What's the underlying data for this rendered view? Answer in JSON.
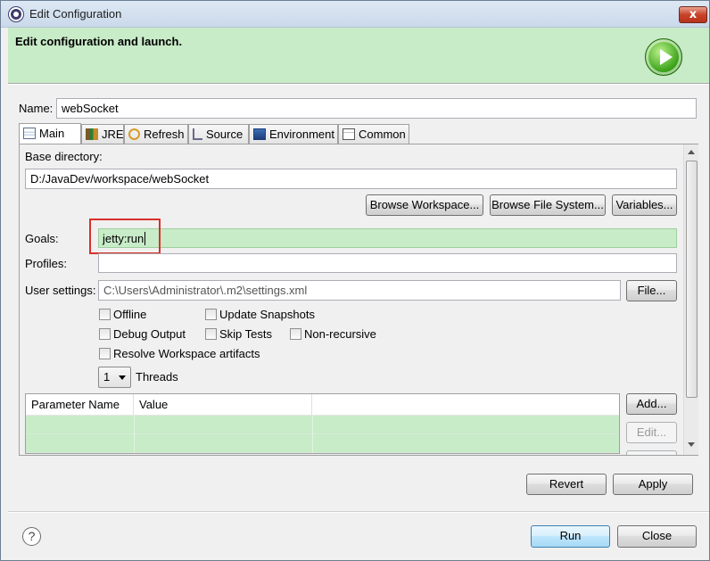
{
  "window": {
    "title": "Edit Configuration",
    "close_glyph": "x"
  },
  "banner": {
    "text": "Edit configuration and launch."
  },
  "name": {
    "label": "Name:",
    "value": "webSocket"
  },
  "tabs": [
    {
      "label": "Main",
      "icon": "document-icon"
    },
    {
      "label": "JRE",
      "icon": "jre-library-icon"
    },
    {
      "label": "Refresh",
      "icon": "refresh-icon"
    },
    {
      "label": "Source",
      "icon": "source-icon"
    },
    {
      "label": "Environment",
      "icon": "environment-icon"
    },
    {
      "label": "Common",
      "icon": "common-icon"
    }
  ],
  "main": {
    "base_dir_label": "Base directory:",
    "base_dir_value": "D:/JavaDev/workspace/webSocket",
    "browse_workspace": "Browse Workspace...",
    "browse_fs": "Browse File System...",
    "variables": "Variables...",
    "goals_label": "Goals:",
    "goals_value": "jetty:run",
    "profiles_label": "Profiles:",
    "profiles_value": "",
    "user_settings_label": "User settings:",
    "user_settings_value": "C:\\Users\\Administrator\\.m2\\settings.xml",
    "file_button": "File...",
    "options": {
      "offline": "Offline",
      "update_snapshots": "Update Snapshots",
      "debug_output": "Debug Output",
      "skip_tests": "Skip Tests",
      "non_recursive": "Non-recursive",
      "resolve_workspace": "Resolve Workspace artifacts"
    },
    "threads_value": "1",
    "threads_label": "Threads",
    "table": {
      "col_name": "Parameter Name",
      "col_value": "Value"
    },
    "add_button": "Add...",
    "edit_button": "Edit..."
  },
  "footer": {
    "revert": "Revert",
    "apply": "Apply",
    "help": "?",
    "run": "Run",
    "close": "Close"
  },
  "colors": {
    "banner_bg": "#c8ebc8",
    "highlight_box": "#d9302b"
  }
}
